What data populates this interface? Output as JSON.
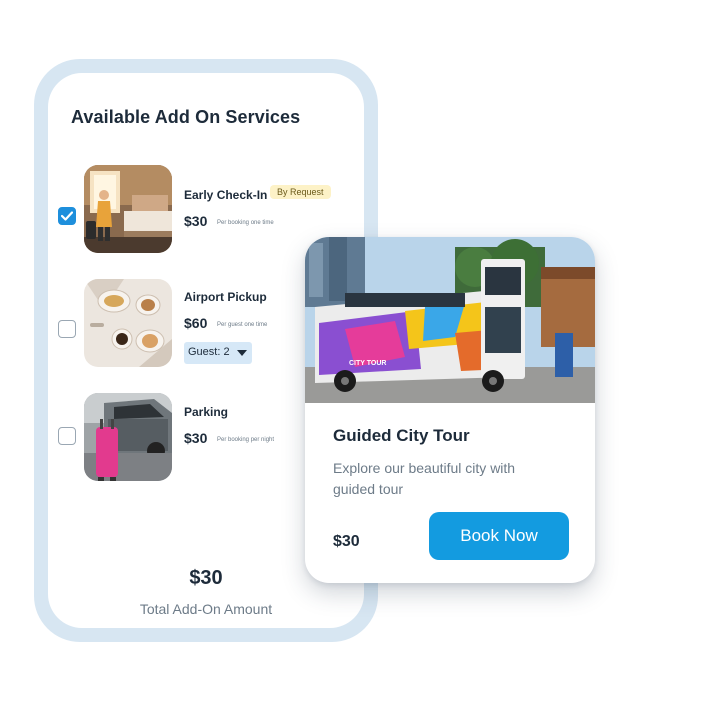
{
  "addons_panel": {
    "title": "Available Add On Services",
    "items": [
      {
        "name": "Early Check-In",
        "badge": "By Request",
        "price": "$30",
        "price_note": "Per booking one time",
        "checked": true
      },
      {
        "name": "Airport Pickup",
        "price": "$60",
        "price_note": "Per guest one time",
        "guest_select": "Guest: 2",
        "checked": false
      },
      {
        "name": "Parking",
        "price": "$30",
        "price_note": "Per booking per night",
        "checked": false
      }
    ],
    "total": {
      "amount": "$30",
      "label": "Total Add-On Amount"
    }
  },
  "tour_card": {
    "title": "Guided City Tour",
    "description": "Explore our beautiful city with guided tour",
    "price": "$30",
    "button_label": "Book Now",
    "bus_sign": "CITY TOUR"
  },
  "colors": {
    "accent": "#139be0",
    "checkbox_checked": "#1e8fdc",
    "frame": "#d7e6f2",
    "badge_bg": "#fdf2c7"
  }
}
